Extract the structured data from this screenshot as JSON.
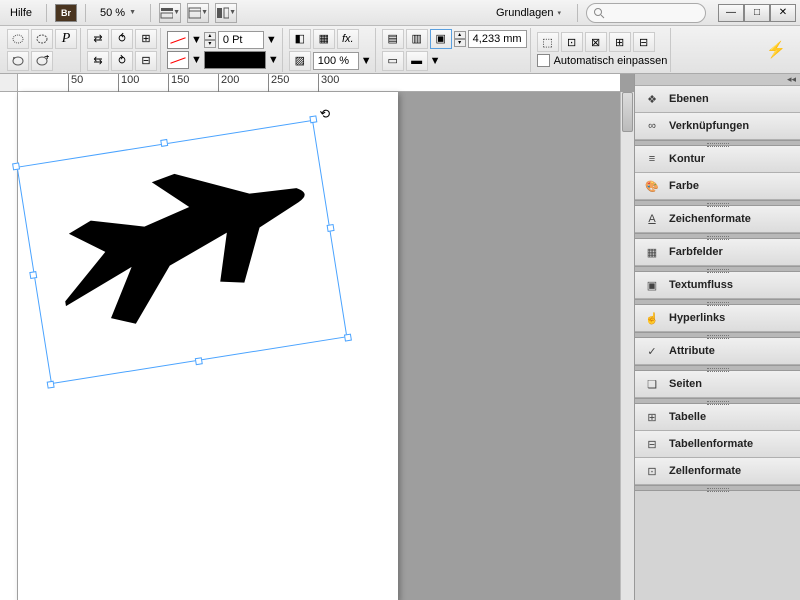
{
  "menubar": {
    "help": "Hilfe",
    "bridge": "Br",
    "zoom": "50 %",
    "workspace": "Grundlagen"
  },
  "toolbar": {
    "stroke_weight": "0 Pt",
    "opacity": "100 %",
    "dimension": "4,233 mm",
    "auto_fit": "Automatisch einpassen"
  },
  "ruler": {
    "ticks": [
      "50",
      "100",
      "150",
      "200",
      "250",
      "300"
    ]
  },
  "panels": {
    "items": [
      {
        "label": "Ebenen",
        "icon": "layers"
      },
      {
        "label": "Verknüpfungen",
        "icon": "links"
      },
      {
        "label": "Kontur",
        "icon": "stroke"
      },
      {
        "label": "Farbe",
        "icon": "color"
      },
      {
        "label": "Zeichenformate",
        "icon": "charstyle"
      },
      {
        "label": "Farbfelder",
        "icon": "swatches"
      },
      {
        "label": "Textumfluss",
        "icon": "textwrap"
      },
      {
        "label": "Hyperlinks",
        "icon": "hyperlink"
      },
      {
        "label": "Attribute",
        "icon": "attribute"
      },
      {
        "label": "Seiten",
        "icon": "pages"
      },
      {
        "label": "Tabelle",
        "icon": "table"
      },
      {
        "label": "Tabellenformate",
        "icon": "tablestyle"
      },
      {
        "label": "Zellenformate",
        "icon": "cellstyle"
      }
    ]
  }
}
